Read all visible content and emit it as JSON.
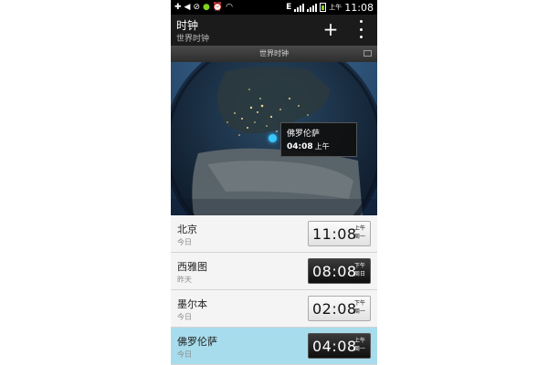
{
  "status_bar": {
    "time": "11:08",
    "ampm": "上午",
    "network_type": "E",
    "icons": [
      "add-icon",
      "back-icon",
      "alarm-icon",
      "wechat-icon",
      "alarm-clock-icon",
      "wifi-icon",
      "signal-icon",
      "battery-icon"
    ]
  },
  "header": {
    "title": "时钟",
    "subtitle": "世界时钟"
  },
  "section": {
    "label": "世界时钟"
  },
  "map": {
    "callout_city": "佛罗伦萨",
    "callout_time": "04:08",
    "callout_ampm": "上午"
  },
  "cities": [
    {
      "name": "北京",
      "day": "今日",
      "time": "11:08",
      "ampm": "上午",
      "weekday": "周一",
      "style": "light"
    },
    {
      "name": "西雅图",
      "day": "昨天",
      "time": "08:08",
      "ampm": "下午",
      "weekday": "周日",
      "style": "dark"
    },
    {
      "name": "墨尔本",
      "day": "今日",
      "time": "02:08",
      "ampm": "下午",
      "weekday": "周一",
      "style": "light"
    },
    {
      "name": "佛罗伦萨",
      "day": "今日",
      "time": "04:08",
      "ampm": "上午",
      "weekday": "周一",
      "style": "dark"
    }
  ],
  "colors": {
    "selected_row": "#a7dcec",
    "location_dot": "#38c7ff",
    "header_bg": "#1b1b1b"
  }
}
